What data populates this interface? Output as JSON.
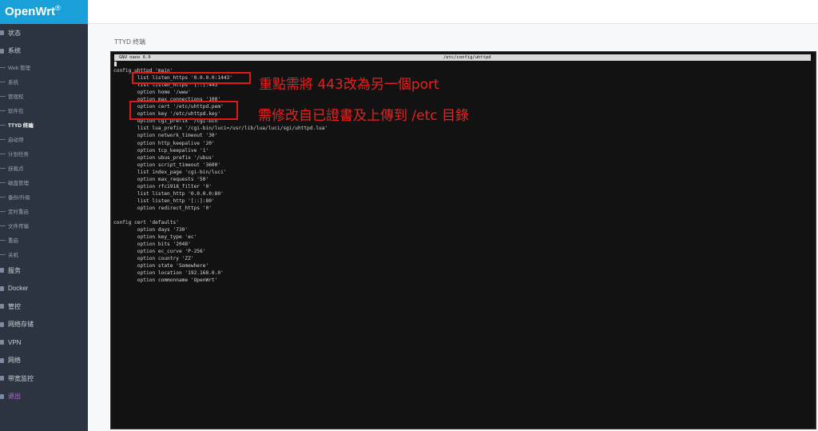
{
  "brand": {
    "name": "OpenWrt",
    "mark": "®"
  },
  "sidebar": {
    "items": [
      {
        "label": "状态",
        "level": "top",
        "icon": "status-icon"
      },
      {
        "label": "系统",
        "level": "top",
        "icon": "system-icon"
      },
      {
        "label": "Web 管理",
        "level": "sub"
      },
      {
        "label": "系统",
        "level": "sub"
      },
      {
        "label": "管理权",
        "level": "sub"
      },
      {
        "label": "软件包",
        "level": "sub"
      },
      {
        "label": "TTYD 终端",
        "level": "sub",
        "active": true
      },
      {
        "label": "启动项",
        "level": "sub"
      },
      {
        "label": "计划任务",
        "level": "sub"
      },
      {
        "label": "挂载点",
        "level": "sub"
      },
      {
        "label": "磁盘管理",
        "level": "sub"
      },
      {
        "label": "备份/升级",
        "level": "sub"
      },
      {
        "label": "定时重启",
        "level": "sub"
      },
      {
        "label": "文件传输",
        "level": "sub"
      },
      {
        "label": "重启",
        "level": "sub"
      },
      {
        "label": "关机",
        "level": "sub"
      },
      {
        "label": "服务",
        "level": "top",
        "icon": "services-icon"
      },
      {
        "label": "Docker",
        "level": "top",
        "icon": "docker-icon"
      },
      {
        "label": "管控",
        "level": "top",
        "icon": "control-icon"
      },
      {
        "label": "网络存储",
        "level": "top",
        "icon": "storage-icon"
      },
      {
        "label": "VPN",
        "level": "top",
        "icon": "vpn-icon"
      },
      {
        "label": "网络",
        "level": "top",
        "icon": "network-icon"
      },
      {
        "label": "带宽监控",
        "level": "top",
        "icon": "bandwidth-icon"
      },
      {
        "label": "退出",
        "level": "top",
        "icon": "logout-icon",
        "logout": true
      }
    ]
  },
  "main": {
    "title": "TTYD 终端"
  },
  "terminal": {
    "nano_version": "GNU nano 6.0",
    "file_path": "/etc/config/uhttpd",
    "lines": [
      "config uhttpd 'main'",
      "        list listen_https '0.0.0.0:1443'",
      "        list listen_https '[::]:443'",
      "        option home '/www'",
      "        option max_connections '100'",
      "        option cert '/etc/uhttpd.pem'",
      "        option key '/etc/uhttpd.key'",
      "        option cgi_prefix '/cgi-bin'",
      "        list lua_prefix '/cgi-bin/luci=/usr/lib/lua/luci/sgi/uhttpd.lua'",
      "        option network_timeout '30'",
      "        option http_keepalive '20'",
      "        option tcp_keepalive '1'",
      "        option ubus_prefix '/ubus'",
      "        option script_timeout '3600'",
      "        list index_page 'cgi-bin/luci'",
      "        option max_requests '50'",
      "        option rfc1918_filter '0'",
      "        list listen_http '0.0.0.0:80'",
      "        list listen_http '[::]:80'",
      "        option redirect_https '0'",
      "",
      "config cert 'defaults'",
      "        option days '730'",
      "        option key_type 'ec'",
      "        option bits '2048'",
      "        option ec_curve 'P-256'",
      "        option country 'ZZ'",
      "        option state 'Somewhere'",
      "        option location '192.168.0.0'",
      "        option commonname 'OpenWrt'"
    ]
  },
  "annotations": {
    "note1": "重點需將 443改為另一個port",
    "note2": "需修改自已證書及上傳到 /etc 目錄",
    "highlight_color": "#e01818"
  }
}
